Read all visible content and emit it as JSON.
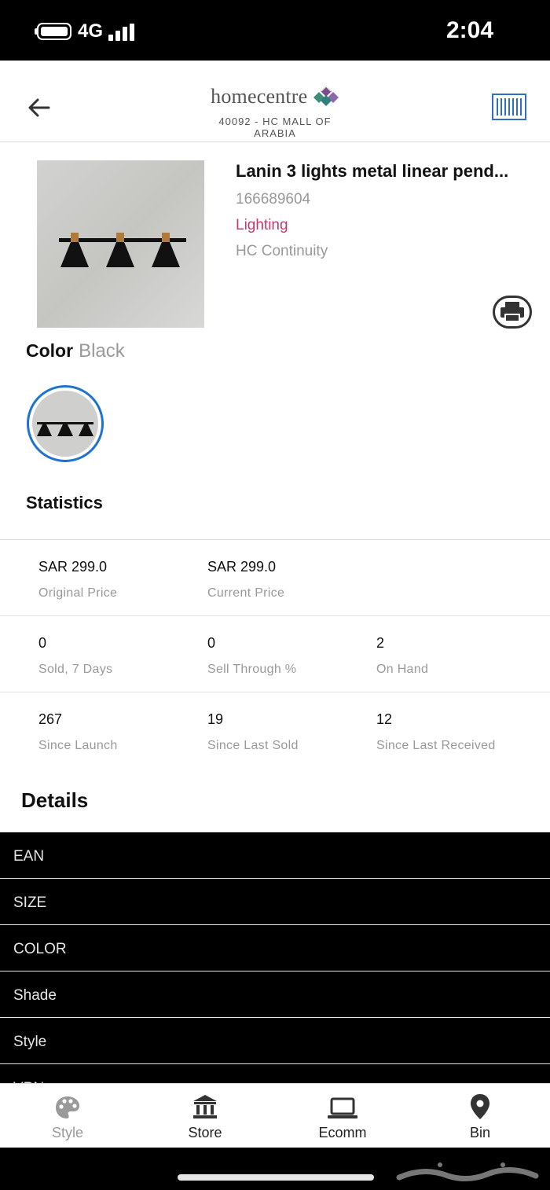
{
  "status_bar": {
    "network": "4G",
    "time": "2:04"
  },
  "header": {
    "brand": "homecentre",
    "store": "40092 - HC MALL OF ARABIA",
    "back_icon": "arrow-left-icon",
    "scan_icon": "barcode-scan-icon",
    "accent_color": "#2f6fc7"
  },
  "product": {
    "title": "Lanin 3 lights metal linear pend...",
    "sku": "166689604",
    "category": "Lighting",
    "program": "HC Continuity",
    "category_color": "#c2386f",
    "print_icon": "printer-icon"
  },
  "color": {
    "label": "Color",
    "value": "Black",
    "swatch_border": "#1e73cf"
  },
  "statistics": {
    "title": "Statistics",
    "rows": [
      [
        {
          "value": "SAR 299.0",
          "label": "Original Price"
        },
        {
          "value": "SAR 299.0",
          "label": "Current Price"
        }
      ],
      [
        {
          "value": "0",
          "label": "Sold, 7 Days"
        },
        {
          "value": "0",
          "label": "Sell Through %"
        },
        {
          "value": "2",
          "label": "On Hand"
        }
      ],
      [
        {
          "value": "267",
          "label": "Since Launch"
        },
        {
          "value": "19",
          "label": "Since Last Sold"
        },
        {
          "value": "12",
          "label": "Since Last Received"
        }
      ]
    ]
  },
  "details": {
    "title": "Details",
    "rows": [
      "EAN",
      "SIZE",
      "COLOR",
      "Shade",
      "Style",
      "VPN"
    ]
  },
  "tabs": [
    {
      "label": "Style",
      "icon": "palette-icon",
      "active": false
    },
    {
      "label": "Store",
      "icon": "bank-building-icon",
      "active": true
    },
    {
      "label": "Ecomm",
      "icon": "laptop-icon",
      "active": true
    },
    {
      "label": "Bin",
      "icon": "map-pin-icon",
      "active": true
    }
  ]
}
